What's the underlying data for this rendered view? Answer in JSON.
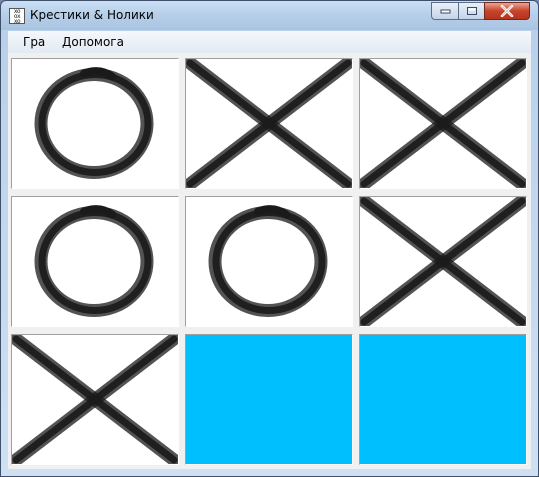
{
  "window": {
    "title": "Крестики & Нолики",
    "icon": "tic-tac-toe-app-icon"
  },
  "menu": {
    "items": [
      {
        "label": "Гра"
      },
      {
        "label": "Допомога"
      }
    ]
  },
  "board": {
    "rows": 3,
    "cols": 3,
    "cells": [
      "O",
      "X",
      "X",
      "O",
      "O",
      "X",
      "X",
      "",
      ""
    ],
    "empty_color": "#00bfff",
    "mark_color": "#1a1a1a"
  }
}
